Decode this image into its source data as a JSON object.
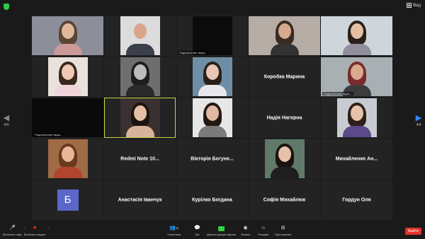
{
  "topbar": {
    "view_label": "Вид"
  },
  "nav": {
    "left_count": "4/4",
    "right_count": "4/4"
  },
  "tiles": [
    {
      "label": ""
    },
    {
      "label": ""
    },
    {
      "label": "Подключение звука..."
    },
    {
      "label": ""
    },
    {
      "label": ""
    },
    {
      "label": ""
    },
    {
      "label": ""
    },
    {
      "label": ""
    },
    {
      "label": "Коробка Марина"
    },
    {
      "label": "Подключение звука..."
    },
    {
      "label": "Подключение звука..."
    },
    {
      "label": ""
    },
    {
      "label": ""
    },
    {
      "label": "Надія Нагорна"
    },
    {
      "label": ""
    },
    {
      "label": ""
    },
    {
      "label": "Redmi Note 10..."
    },
    {
      "label": "Вікторія Богуне..."
    },
    {
      "label": ""
    },
    {
      "label": "Михайленко Ан..."
    },
    {
      "label": "Б"
    },
    {
      "label": "Анастасія Іванчук"
    },
    {
      "label": "Курілко Богдана"
    },
    {
      "label": "Софія Михайлюк"
    },
    {
      "label": "Гордун Оля"
    }
  ],
  "toolbar": {
    "mute": "Включить звук",
    "video": "Включить видео",
    "participants": "Участники",
    "participants_count": "25",
    "chat": "Чат",
    "share": "Демонстрация экрана",
    "record": "Запись",
    "reactions": "Реакции",
    "apps": "Приложения",
    "end": "Выйти"
  },
  "colors": {
    "accent": "#2d8cff",
    "end": "#e5322c",
    "active_border": "#c7d84a",
    "avatar": "#5b67c8"
  }
}
